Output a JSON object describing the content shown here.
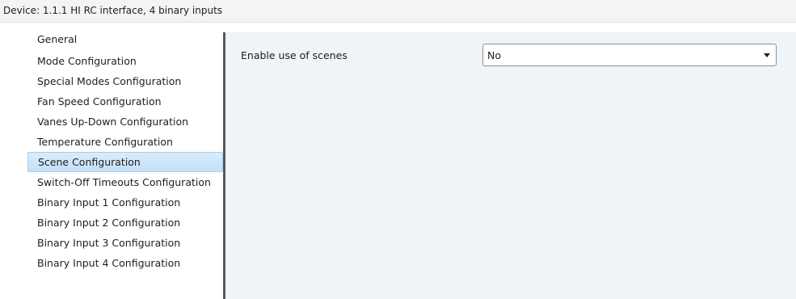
{
  "header": {
    "device_title": "Device: 1.1.1  HI RC interface, 4 binary inputs"
  },
  "sidebar": {
    "items": [
      {
        "label": "General"
      },
      {
        "label": "Mode Configuration"
      },
      {
        "label": "Special Modes Configuration"
      },
      {
        "label": "Fan Speed Configuration"
      },
      {
        "label": "Vanes Up-Down Configuration"
      },
      {
        "label": "Temperature Configuration"
      },
      {
        "label": "Scene Configuration"
      },
      {
        "label": "Switch-Off Timeouts Configuration"
      },
      {
        "label": "Binary Input 1 Configuration"
      },
      {
        "label": "Binary Input 2 Configuration"
      },
      {
        "label": "Binary Input 3 Configuration"
      },
      {
        "label": "Binary Input 4 Configuration"
      }
    ],
    "selected_item": "Scene Configuration"
  },
  "main": {
    "parameters": [
      {
        "label": "Enable use of scenes",
        "value": "No",
        "icon": "chevron-down-icon"
      }
    ]
  },
  "colors": {
    "header_bg": "#f4f4f4",
    "content_bg": "#eef4f8",
    "selection_bg": "#cfe6fa",
    "selection_border": "#a9cdec",
    "splitter": "#5a5a5a"
  }
}
